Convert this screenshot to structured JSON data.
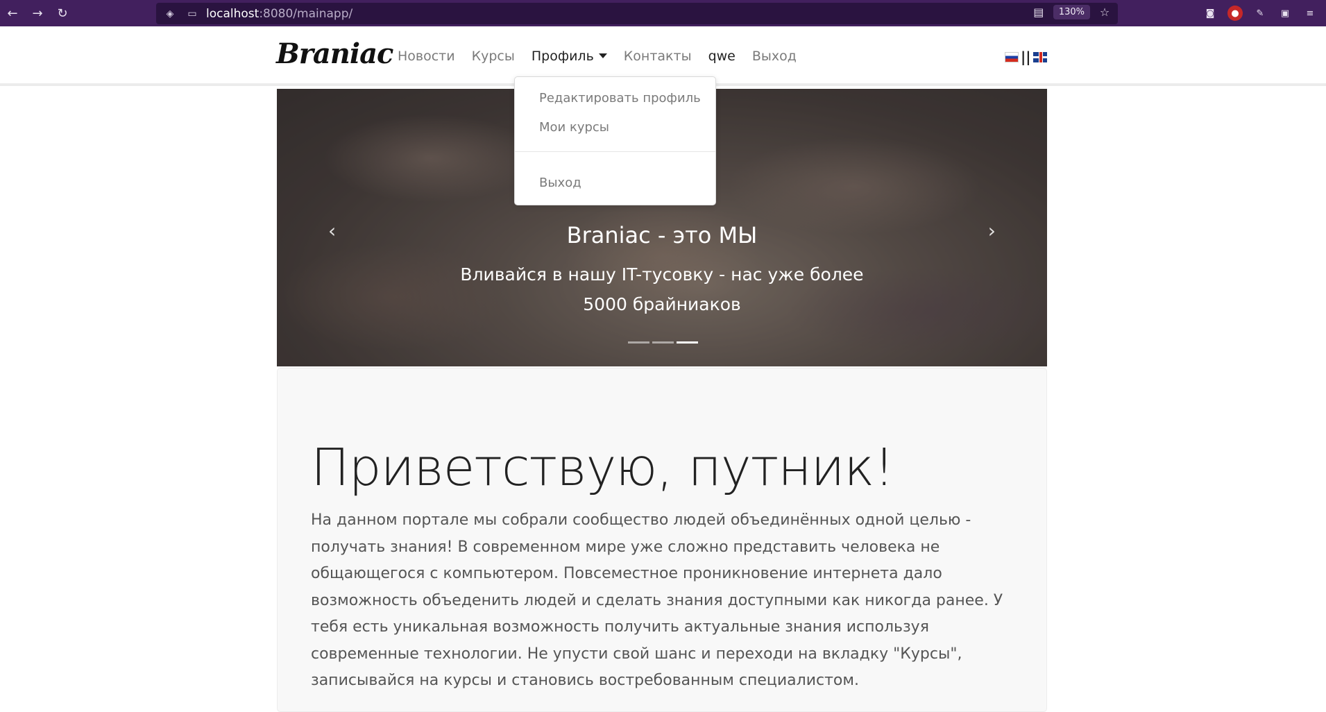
{
  "browser": {
    "url_host": "localhost",
    "url_path": ":8080/mainapp/",
    "zoom": "130%"
  },
  "navbar": {
    "brand": "Braniac",
    "links": [
      "Новости",
      "Курсы",
      "Профиль",
      "Контакты",
      "qwe",
      "Выход"
    ],
    "lang_separator": "||"
  },
  "dropdown": {
    "items": [
      "Редактировать профиль",
      "Мои курсы",
      "Выход"
    ]
  },
  "carousel": {
    "title": "Braniac - это МЫ",
    "text": "Вливайся в нашу IT-тусовку - нас уже более 5000 брайниаков",
    "prev_icon": "‹",
    "next_icon": "›",
    "slide_count": 3,
    "active_slide": 3
  },
  "jumbotron": {
    "title": "Приветствую, путник!",
    "text": "На данном портале мы собрали сообщество людей объединённых одной целью - получать знания! В современном мире уже сложно представить человека не общающегося с компьютером. Повсеместное проникновение интернета дало возможность объеденить людей и сделать знания доступными как никогда ранее. У тебя есть уникальная возможность получить актуальные знания используя современные технологии. Не упусти свой шанс и переходи на вкладку \"Курсы\", записывайся на курсы и становись востребованным специалистом."
  }
}
